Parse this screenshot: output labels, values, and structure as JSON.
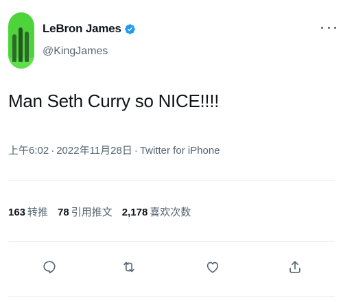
{
  "user": {
    "display_name": "LeBron James",
    "handle": "@KingJames",
    "verified": true,
    "verified_color": "#1d9bf0",
    "avatar_icon": "avatar-photo"
  },
  "tweet": {
    "text": "Man Seth Curry so NICE!!!!",
    "time": "上午6:02",
    "date": "2022年11月28日",
    "source": "Twitter for iPhone",
    "separator": "·"
  },
  "stats": [
    {
      "count": "163",
      "label": "转推"
    },
    {
      "count": "78",
      "label": "引用推文"
    },
    {
      "count": "2,178",
      "label": "喜欢次数"
    }
  ],
  "actions": [
    {
      "name": "reply",
      "icon": "reply-icon"
    },
    {
      "name": "retweet",
      "icon": "retweet-icon"
    },
    {
      "name": "like",
      "icon": "heart-icon"
    },
    {
      "name": "share",
      "icon": "share-icon"
    }
  ],
  "colors": {
    "text": "#0f1419",
    "secondary": "#536471",
    "divider": "#e6e9ec"
  }
}
